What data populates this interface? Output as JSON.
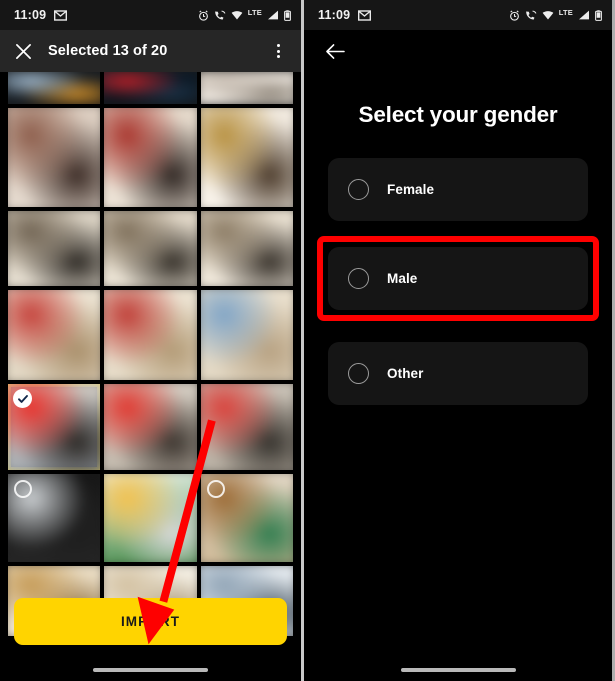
{
  "left_phone": {
    "status_bar": {
      "time": "11:09",
      "left_icons": [
        "gmail-icon"
      ],
      "right_icons": [
        "alarm-icon",
        "call-wifi-icon",
        "wifi-icon",
        "signal-icon",
        "battery-icon"
      ],
      "network_label": "LTE"
    },
    "toolbar": {
      "close_label": "✕",
      "title": "Selected 13 of 20",
      "overflow_label": "more-options"
    },
    "gallery": {
      "rows": [
        {
          "id": "row-1",
          "height": 32,
          "cells": [
            {
              "id": "cell-1-1",
              "type": "screenshot",
              "selected": false,
              "badge": "none",
              "palette": [
                "#1d2a38",
                "#9fb6c9",
                "#c98b2a",
                "#0d0d0d"
              ]
            },
            {
              "id": "cell-1-2",
              "type": "screenshot",
              "selected": false,
              "badge": "none",
              "palette": [
                "#10253a",
                "#b81f26",
                "#1b3247",
                "#070707"
              ]
            },
            {
              "id": "cell-1-3",
              "type": "screenshot",
              "selected": false,
              "badge": "none",
              "palette": [
                "#e7ded4",
                "#c7bdb2",
                "#8e8579",
                "#f2eee8"
              ]
            }
          ]
        },
        {
          "id": "row-2",
          "height": 99,
          "cells": [
            {
              "id": "cell-2-1",
              "type": "photo",
              "selected": false,
              "badge": "none",
              "palette": [
                "#d9c9bb",
                "#8c5c4a",
                "#3a2a24",
                "#e8ded3"
              ]
            },
            {
              "id": "cell-2-2",
              "type": "photo",
              "selected": false,
              "badge": "none",
              "palette": [
                "#e2d5c6",
                "#a8342c",
                "#2d2420",
                "#efe6da"
              ]
            },
            {
              "id": "cell-2-3",
              "type": "photo",
              "selected": false,
              "badge": "none",
              "palette": [
                "#eee6da",
                "#b7903f",
                "#4b3a2a",
                "#fbf6ee"
              ]
            }
          ]
        },
        {
          "id": "row-3",
          "height": 75,
          "cells": [
            {
              "id": "cell-3-1",
              "type": "photo",
              "selected": false,
              "badge": "none",
              "palette": [
                "#d6cdbd",
                "#6f6251",
                "#2b2722",
                "#eae3d6"
              ]
            },
            {
              "id": "cell-3-2",
              "type": "photo",
              "selected": false,
              "badge": "none",
              "palette": [
                "#ded3c2",
                "#7d6e59",
                "#332e27",
                "#efe8da"
              ]
            },
            {
              "id": "cell-3-3",
              "type": "photo",
              "selected": false,
              "badge": "none",
              "palette": [
                "#e6dccb",
                "#8a7a63",
                "#37312a",
                "#f3ece0"
              ]
            }
          ]
        },
        {
          "id": "row-4",
          "height": 90,
          "cells": [
            {
              "id": "cell-4-1",
              "type": "photo",
              "selected": false,
              "badge": "none",
              "palette": [
                "#f0e7d7",
                "#c5413a",
                "#a98f6a",
                "#ddd2bd"
              ]
            },
            {
              "id": "cell-4-2",
              "type": "photo",
              "selected": false,
              "badge": "none",
              "palette": [
                "#efe6d6",
                "#bf3c35",
                "#b29a75",
                "#e3d8c3"
              ]
            },
            {
              "id": "cell-4-3",
              "type": "photo",
              "selected": false,
              "badge": "none",
              "palette": [
                "#ece2d0",
                "#7fa4c6",
                "#b7a181",
                "#e0d5c0"
              ]
            }
          ]
        },
        {
          "id": "row-5",
          "height": 86,
          "cells": [
            {
              "id": "cell-5-1",
              "type": "photo",
              "selected": true,
              "badge": "check",
              "palette": [
                "#d8cfc3",
                "#e8302b",
                "#2a2724",
                "#9aa3ad"
              ]
            },
            {
              "id": "cell-5-2",
              "type": "photo",
              "selected": false,
              "badge": "none",
              "palette": [
                "#d9d2c8",
                "#e0372f",
                "#3a332d",
                "#bcb3a6"
              ]
            },
            {
              "id": "cell-5-3",
              "type": "photo",
              "selected": false,
              "badge": "none",
              "palette": [
                "#cfc8bd",
                "#d9403a",
                "#33302b",
                "#b3aa9d"
              ]
            }
          ]
        },
        {
          "id": "row-6",
          "height": 88,
          "cells": [
            {
              "id": "cell-6-1",
              "type": "screenshot",
              "selected": false,
              "badge": "circle",
              "palette": [
                "#111111",
                "#cfd3d6",
                "#1e1e1e",
                "#2b2b2b"
              ]
            },
            {
              "id": "cell-6-2",
              "type": "screenshot",
              "selected": false,
              "badge": "none",
              "palette": [
                "#ffffff",
                "#f2c14e",
                "#d9d9d9",
                "#2f7d32"
              ]
            },
            {
              "id": "cell-6-3",
              "type": "photo",
              "selected": false,
              "badge": "circle",
              "palette": [
                "#e7e0d4",
                "#9b6a34",
                "#2f7d4f",
                "#c9b089"
              ]
            }
          ]
        },
        {
          "id": "row-7",
          "height": 70,
          "cells": [
            {
              "id": "cell-7-1",
              "type": "screenshot",
              "selected": false,
              "badge": "none",
              "palette": [
                "#e8d9bd",
                "#c59a55",
                "#8a6a3a",
                "#f3e9d6"
              ]
            },
            {
              "id": "cell-7-2",
              "type": "screenshot",
              "selected": false,
              "badge": "none",
              "palette": [
                "#f2ecdf",
                "#d2c0a0",
                "#a08d6c",
                "#fbf7ee"
              ]
            },
            {
              "id": "cell-7-3",
              "type": "screenshot",
              "selected": false,
              "badge": "none",
              "palette": [
                "#dfe6ec",
                "#8fa3b5",
                "#3a4a58",
                "#f0f4f7"
              ]
            }
          ]
        }
      ]
    },
    "import_button": {
      "label": "IMPORT",
      "background": "#ffd400",
      "text_color": "#1a1a1a"
    },
    "annotation": {
      "arrow_color": "#fe0000",
      "arrow_target": "import-button"
    }
  },
  "right_phone": {
    "status_bar": {
      "time": "11:09",
      "left_icons": [
        "gmail-icon"
      ],
      "right_icons": [
        "alarm-icon",
        "call-wifi-icon",
        "wifi-icon",
        "signal-icon",
        "battery-icon"
      ],
      "network_label": "LTE"
    },
    "appbar": {
      "back_label": "back"
    },
    "screen": {
      "title": "Select your gender",
      "options": [
        {
          "id": "female",
          "label": "Female",
          "selected": false,
          "highlighted": false
        },
        {
          "id": "male",
          "label": "Male",
          "selected": false,
          "highlighted": true
        },
        {
          "id": "other",
          "label": "Other",
          "selected": false,
          "highlighted": false
        }
      ]
    },
    "annotation": {
      "highlight_color": "#fe0000",
      "highlight_target": "male"
    }
  }
}
